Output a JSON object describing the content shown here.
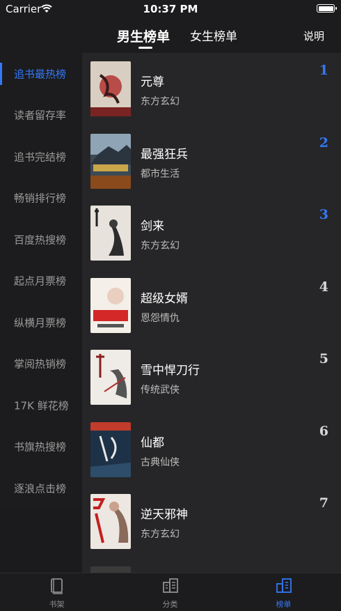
{
  "status_bar": {
    "carrier": "Carrier",
    "time": "10:37 PM"
  },
  "header": {
    "tabs": [
      {
        "label": "男生榜单",
        "active": true
      },
      {
        "label": "女生榜单",
        "active": false
      }
    ],
    "explain_label": "说明"
  },
  "sidebar": {
    "items": [
      {
        "label": "追书最热榜",
        "active": true
      },
      {
        "label": "读者留存率"
      },
      {
        "label": "追书完结榜"
      },
      {
        "label": "畅销排行榜"
      },
      {
        "label": "百度热搜榜"
      },
      {
        "label": "起点月票榜"
      },
      {
        "label": "纵横月票榜"
      },
      {
        "label": "掌阅热销榜"
      },
      {
        "label": "17K 鲜花榜"
      },
      {
        "label": "书旗热搜榜"
      },
      {
        "label": "逐浪点击榜"
      }
    ]
  },
  "books": [
    {
      "title": "元尊",
      "genre": "东方玄幻",
      "rank": "1"
    },
    {
      "title": "最强狂兵",
      "genre": "都市生活",
      "rank": "2"
    },
    {
      "title": "剑来",
      "genre": "东方玄幻",
      "rank": "3"
    },
    {
      "title": "超级女婿",
      "genre": "恩怨情仇",
      "rank": "4"
    },
    {
      "title": "雪中悍刀行",
      "genre": "传统武侠",
      "rank": "5"
    },
    {
      "title": "仙都",
      "genre": "古典仙侠",
      "rank": "6"
    },
    {
      "title": "逆天邪神",
      "genre": "东方玄幻",
      "rank": "7"
    }
  ],
  "tabbar": {
    "items": [
      {
        "label": "书架",
        "icon": "book-icon"
      },
      {
        "label": "分类",
        "icon": "category-icon"
      },
      {
        "label": "榜单",
        "icon": "ranking-icon",
        "active": true
      }
    ]
  },
  "colors": {
    "accent": "#3478f6",
    "background": "#1c1c1e",
    "list_background": "#262628"
  }
}
